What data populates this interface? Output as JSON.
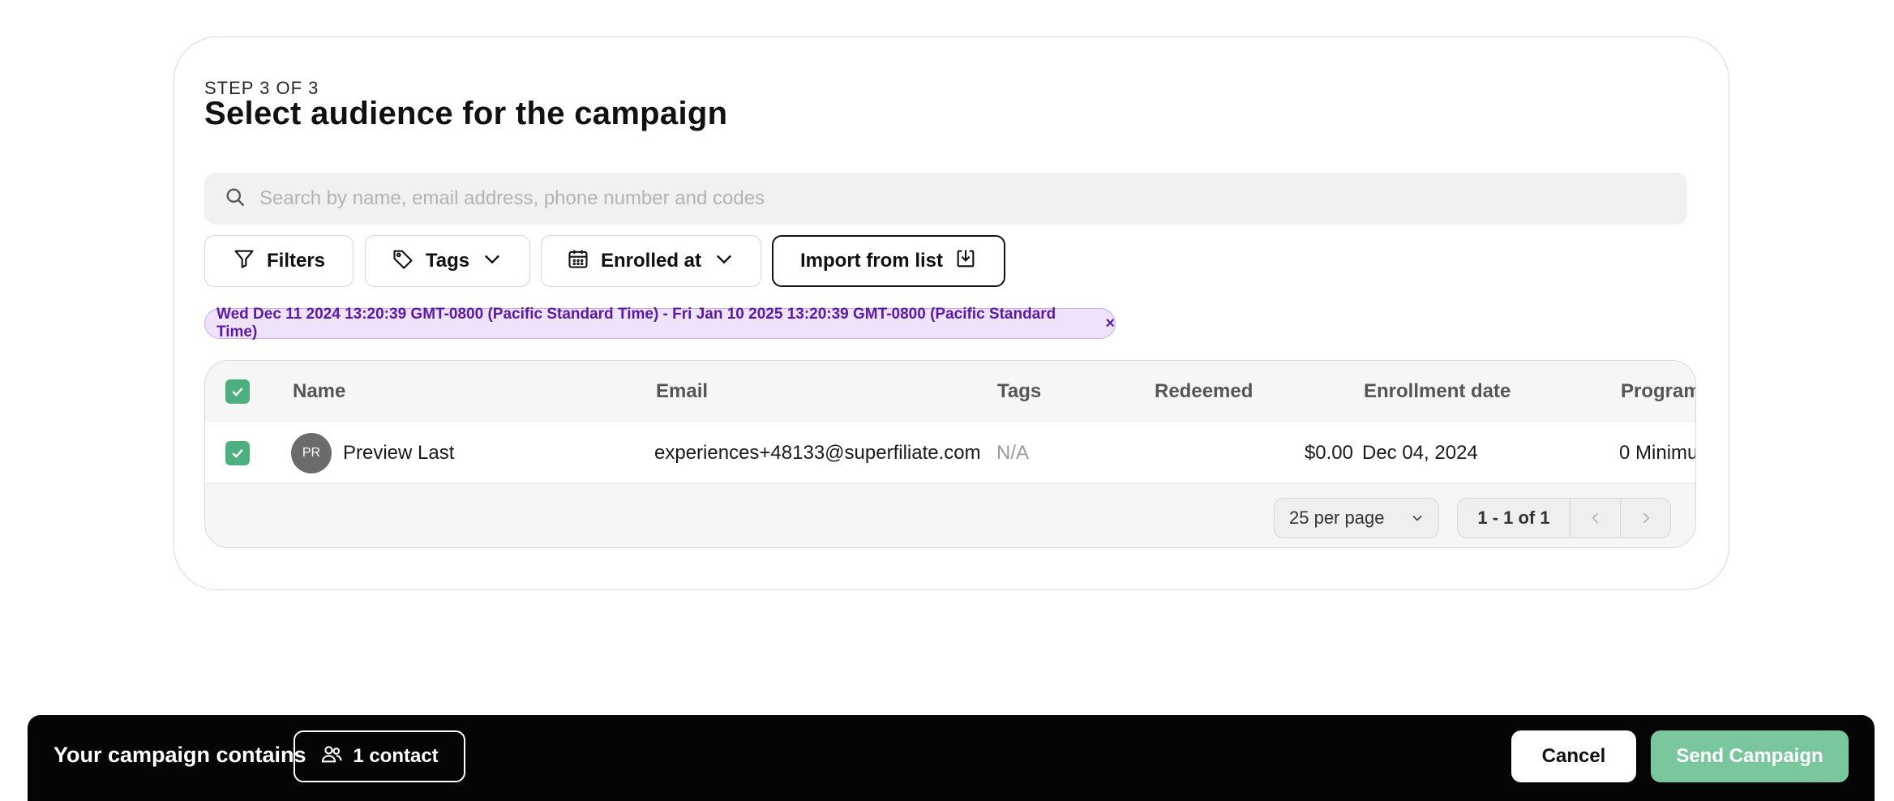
{
  "header": {
    "step": "STEP 3 OF 3",
    "title": "Select audience for the campaign"
  },
  "search": {
    "placeholder": "Search by name, email address, phone number and codes",
    "value": ""
  },
  "toolbar": {
    "filters_label": "Filters",
    "tags_label": "Tags",
    "enrolled_label": "Enrolled at",
    "import_label": "Import from list"
  },
  "active_filter": {
    "label": "Wed Dec 11 2024 13:20:39 GMT-0800 (Pacific Standard Time) - Fri Jan 10 2025 13:20:39 GMT-0800 (Pacific Standard Time)",
    "remove": "×"
  },
  "table": {
    "columns": [
      "Name",
      "Email",
      "Tags",
      "Redeemed",
      "Enrollment date",
      "Program"
    ],
    "rows": [
      {
        "initials": "PR",
        "name": "Preview Last",
        "email": "experiences+48133@superfiliate.com",
        "tags": "N/A",
        "redeemed": "$0.00",
        "enrollment_date": "Dec 04, 2024",
        "program": "0 Minimu"
      }
    ]
  },
  "pagination": {
    "per_page": "25 per page",
    "range": "1 - 1 of 1"
  },
  "footer": {
    "label": "Your campaign contains",
    "contacts": "1 contact",
    "cancel": "Cancel",
    "send": "Send Campaign"
  },
  "colors": {
    "check": "#4caf7d",
    "chip_bg": "#eee3fb",
    "chip_text": "#5a1aa6",
    "send_button": "#7bc79d",
    "footer_bg": "#050505"
  }
}
